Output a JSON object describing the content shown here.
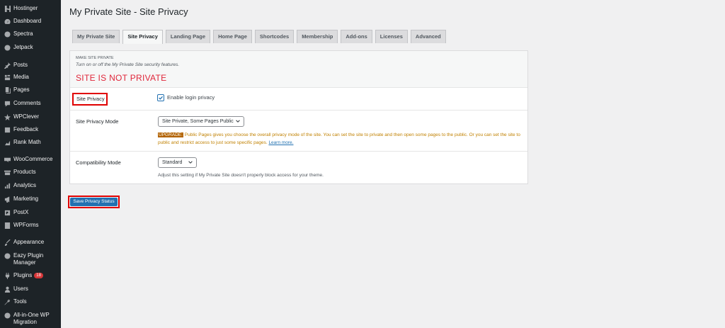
{
  "sidebar": {
    "items": [
      {
        "label": "Hostinger",
        "icon": "hostinger-icon"
      },
      {
        "label": "Dashboard",
        "icon": "dashboard-icon"
      },
      {
        "label": "Spectra",
        "icon": "spectra-icon"
      },
      {
        "label": "Jetpack",
        "icon": "jetpack-icon"
      },
      {
        "label": "Posts",
        "icon": "pin-icon"
      },
      {
        "label": "Media",
        "icon": "media-icon"
      },
      {
        "label": "Pages",
        "icon": "pages-icon"
      },
      {
        "label": "Comments",
        "icon": "comment-icon"
      },
      {
        "label": "WPClever",
        "icon": "wpclever-icon"
      },
      {
        "label": "Feedback",
        "icon": "feedback-icon"
      },
      {
        "label": "Rank Math",
        "icon": "rankmath-icon"
      },
      {
        "label": "WooCommerce",
        "icon": "woocommerce-icon"
      },
      {
        "label": "Products",
        "icon": "products-icon"
      },
      {
        "label": "Analytics",
        "icon": "analytics-icon"
      },
      {
        "label": "Marketing",
        "icon": "megaphone-icon"
      },
      {
        "label": "PostX",
        "icon": "postx-icon"
      },
      {
        "label": "WPForms",
        "icon": "wpforms-icon"
      },
      {
        "label": "Appearance",
        "icon": "brush-icon"
      },
      {
        "label": "Eazy Plugin Manager",
        "icon": "plugin-manager-icon"
      },
      {
        "label": "Plugins",
        "icon": "plugin-icon",
        "badge": "18"
      },
      {
        "label": "Users",
        "icon": "users-icon"
      },
      {
        "label": "Tools",
        "icon": "wrench-icon"
      },
      {
        "label": "All-in-One WP Migration",
        "icon": "migration-icon"
      }
    ]
  },
  "page": {
    "title": "My Private Site - Site Privacy"
  },
  "tabs": [
    {
      "label": "My Private Site"
    },
    {
      "label": "Site Privacy",
      "active": true
    },
    {
      "label": "Landing Page"
    },
    {
      "label": "Home Page"
    },
    {
      "label": "Shortcodes"
    },
    {
      "label": "Membership"
    },
    {
      "label": "Add-ons"
    },
    {
      "label": "Licenses"
    },
    {
      "label": "Advanced"
    }
  ],
  "section": {
    "title": "MAKE SITE PRIVATE",
    "description": "Turn on or off the My Private Site security features.",
    "status": "SITE IS NOT PRIVATE"
  },
  "privacy": {
    "label": "Site Privacy",
    "checkbox_label": "Enable login privacy",
    "checked": true
  },
  "mode": {
    "label": "Site Privacy Mode",
    "selected": "Site Private, Some Pages Public",
    "upgrade_badge": "UPGRADE:",
    "upgrade_text": " Public Pages gives you choose the overall privacy mode of the site. You can set the site to private and then open some pages to the public. Or you can set the site to public and restrict access to just some specific pages. ",
    "learn_more": "Learn more."
  },
  "compat": {
    "label": "Compatibility Mode",
    "selected": "Standard",
    "help": "Adjust this setting if My Private Site doesn't properly block access for your theme."
  },
  "save": {
    "label": "Save Privacy Status"
  },
  "colors": {
    "sidebar_bg": "#1d2327",
    "accent": "#2271b1",
    "status_red": "#e0263a",
    "highlight_red": "#e00000",
    "upgrade_orange": "#c08000"
  }
}
